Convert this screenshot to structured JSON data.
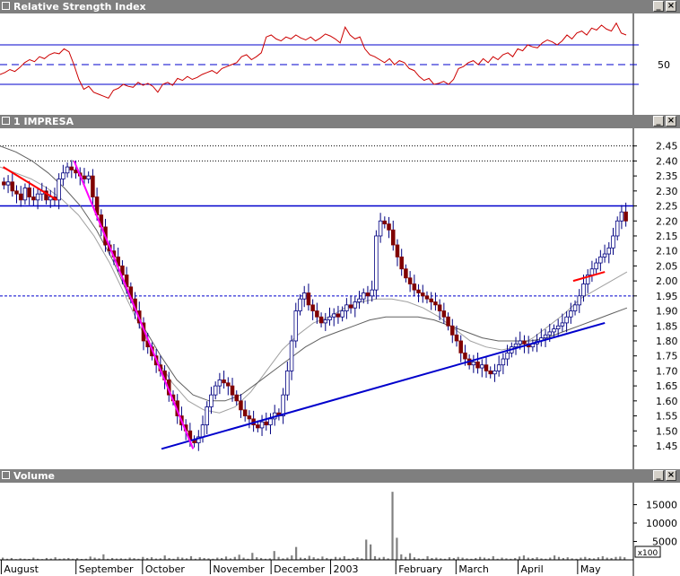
{
  "panels": {
    "rsi": {
      "title": "Relative Strength Index"
    },
    "price": {
      "title": "1 IMPRESA"
    },
    "volume": {
      "title": "Volume"
    }
  },
  "window_controls": {
    "minimize": "_",
    "close": "×"
  },
  "colors": {
    "titlebar": "#7f7f7f",
    "rsi_line": "#cc0000",
    "rsi_guides": "#0000cc",
    "trendline": "#0000cc",
    "magenta_trend": "#ff00ff",
    "red_trend": "#ff0000",
    "candle_down": "#800000",
    "candle_up_fill": "#ffffff",
    "candle_outline": "#000080",
    "ma_short": "#a0a0a0",
    "ma_long": "#606060",
    "volume_bar": "#808080"
  },
  "chart_data": [
    {
      "type": "line",
      "panel": "rsi",
      "ytick_labels": [
        "50"
      ],
      "levels": {
        "upper": 70,
        "mid": 50,
        "lower": 30
      },
      "ylim": [
        0,
        100
      ],
      "series": [
        {
          "values": [
            40,
            42,
            45,
            43,
            47,
            52,
            55,
            53,
            58,
            56,
            60,
            62,
            61,
            66,
            63,
            50,
            35,
            25,
            28,
            22,
            20,
            18,
            16,
            24,
            26,
            30,
            28,
            27,
            32,
            29,
            31,
            28,
            22,
            30,
            32,
            29,
            36,
            34,
            38,
            35,
            37,
            40,
            42,
            44,
            41,
            46,
            48,
            50,
            52,
            58,
            60,
            55,
            58,
            62,
            78,
            80,
            76,
            74,
            78,
            76,
            80,
            77,
            75,
            78,
            74,
            77,
            81,
            79,
            76,
            72,
            88,
            80,
            76,
            78,
            66,
            60,
            58,
            55,
            52,
            56,
            50,
            54,
            52,
            46,
            44,
            38,
            34,
            36,
            30,
            31,
            33,
            30,
            35,
            46,
            48,
            52,
            54,
            50,
            56,
            52,
            58,
            55,
            60,
            62,
            58,
            66,
            64,
            70,
            68,
            67,
            72,
            75,
            73,
            70,
            74,
            80,
            76,
            82,
            84,
            80,
            87,
            85,
            90,
            86,
            84,
            92,
            82,
            80
          ]
        }
      ]
    },
    {
      "type": "candlestick",
      "panel": "price",
      "x_labels": [
        "August",
        "September",
        "October",
        "November",
        "December",
        "2003",
        "February",
        "March",
        "April",
        "May"
      ],
      "ytick_labels": [
        "2.45",
        "2.40",
        "2.35",
        "2.30",
        "2.25",
        "2.20",
        "2.15",
        "2.10",
        "2.05",
        "2.00",
        "1.95",
        "1.90",
        "1.85",
        "1.80",
        "1.75",
        "1.70",
        "1.65",
        "1.60",
        "1.55",
        "1.50",
        "1.45"
      ],
      "ylim": [
        1.42,
        2.47
      ],
      "horizontal_levels": [
        2.25,
        1.95,
        2.4
      ],
      "close": [
        2.32,
        2.33,
        2.3,
        2.29,
        2.27,
        2.31,
        2.28,
        2.27,
        2.29,
        2.3,
        2.27,
        2.28,
        2.27,
        2.34,
        2.36,
        2.38,
        2.37,
        2.36,
        2.35,
        2.34,
        2.35,
        2.28,
        2.22,
        2.18,
        2.12,
        2.1,
        2.08,
        2.05,
        2.02,
        1.98,
        1.94,
        1.9,
        1.86,
        1.8,
        1.78,
        1.75,
        1.72,
        1.7,
        1.67,
        1.62,
        1.6,
        1.55,
        1.52,
        1.5,
        1.47,
        1.46,
        1.48,
        1.52,
        1.58,
        1.62,
        1.65,
        1.67,
        1.66,
        1.65,
        1.62,
        1.6,
        1.57,
        1.55,
        1.54,
        1.52,
        1.51,
        1.53,
        1.52,
        1.54,
        1.56,
        1.55,
        1.62,
        1.7,
        1.8,
        1.9,
        1.94,
        1.96,
        1.92,
        1.9,
        1.88,
        1.86,
        1.87,
        1.88,
        1.89,
        1.88,
        1.9,
        1.92,
        1.91,
        1.93,
        1.94,
        1.96,
        1.95,
        1.97,
        2.15,
        2.2,
        2.19,
        2.17,
        2.12,
        2.08,
        2.04,
        2.01,
        1.99,
        1.97,
        1.96,
        1.95,
        1.94,
        1.93,
        1.92,
        1.9,
        1.88,
        1.85,
        1.82,
        1.8,
        1.76,
        1.74,
        1.72,
        1.73,
        1.71,
        1.72,
        1.7,
        1.69,
        1.7,
        1.72,
        1.74,
        1.76,
        1.78,
        1.79,
        1.8,
        1.79,
        1.78,
        1.79,
        1.8,
        1.81,
        1.82,
        1.83,
        1.84,
        1.85,
        1.86,
        1.88,
        1.9,
        1.92,
        1.95,
        1.99,
        2.02,
        2.04,
        2.06,
        2.08,
        2.09,
        2.11,
        2.15,
        2.2,
        2.23,
        2.2
      ],
      "moving_averages": [
        {
          "values": [
            2.38,
            2.36,
            2.34,
            2.31,
            2.27,
            2.22,
            2.15,
            2.06,
            1.95,
            1.84,
            1.74,
            1.66,
            1.6,
            1.57,
            1.56,
            1.58,
            1.63,
            1.7,
            1.77,
            1.82,
            1.86,
            1.88,
            1.91,
            1.93,
            1.94,
            1.94,
            1.93,
            1.91,
            1.88,
            1.84,
            1.8,
            1.78,
            1.77,
            1.78,
            1.81,
            1.85,
            1.89,
            1.94,
            1.97,
            2.0,
            2.03
          ]
        },
        {
          "values": [
            2.45,
            2.43,
            2.4,
            2.36,
            2.31,
            2.25,
            2.17,
            2.07,
            1.95,
            1.84,
            1.75,
            1.67,
            1.62,
            1.6,
            1.6,
            1.62,
            1.66,
            1.7,
            1.74,
            1.78,
            1.81,
            1.83,
            1.85,
            1.87,
            1.88,
            1.88,
            1.88,
            1.87,
            1.85,
            1.83,
            1.81,
            1.8,
            1.8,
            1.8,
            1.81,
            1.83,
            1.85,
            1.87,
            1.89,
            1.91
          ]
        }
      ],
      "trendlines": [
        {
          "kind": "support",
          "from": [
            0.255,
            1.44
          ],
          "to": [
            0.955,
            1.86
          ]
        },
        {
          "kind": "steep-down",
          "from": [
            0.117,
            2.4
          ],
          "to": [
            0.305,
            1.44
          ]
        },
        {
          "kind": "short-down",
          "from": [
            0.005,
            2.38
          ],
          "to": [
            0.09,
            2.27
          ]
        },
        {
          "kind": "short-up",
          "from": [
            0.905,
            2.0
          ],
          "to": [
            0.955,
            2.03
          ]
        }
      ]
    },
    {
      "type": "bar",
      "panel": "volume",
      "ytick_labels": [
        "15000",
        "10000",
        "5000"
      ],
      "scale_label": "x100",
      "ylim": [
        0,
        20000
      ],
      "values": [
        600,
        300,
        500,
        200,
        400,
        300,
        250,
        600,
        300,
        200,
        500,
        350,
        700,
        300,
        400,
        500,
        300,
        450,
        250,
        300,
        900,
        600,
        400,
        1500,
        300,
        500,
        350,
        400,
        300,
        600,
        450,
        300,
        800,
        500,
        700,
        350,
        400,
        1200,
        500,
        300,
        800,
        600,
        400,
        1000,
        300,
        700,
        500,
        400,
        300,
        600,
        500,
        900,
        400,
        800,
        1400,
        600,
        300,
        1900,
        700,
        500,
        300,
        400,
        2400,
        800,
        400,
        600,
        1200,
        3500,
        600,
        500,
        1100,
        700,
        400,
        900,
        500,
        300,
        800,
        600,
        1000,
        300,
        500,
        700,
        400,
        5500,
        4200,
        1000,
        600,
        800,
        400,
        18500,
        6000,
        1500,
        800,
        1800,
        700,
        400,
        300,
        1000,
        500,
        600,
        400,
        300,
        700,
        500,
        800,
        600,
        400,
        300,
        500,
        800,
        600,
        400,
        1000,
        300,
        600,
        400,
        300,
        500,
        900,
        1200,
        600,
        500,
        700,
        400,
        300,
        600,
        1200,
        800,
        500,
        700,
        400,
        300,
        600,
        800,
        500,
        400,
        700,
        1000,
        600,
        500,
        800,
        900,
        700
      ]
    }
  ]
}
